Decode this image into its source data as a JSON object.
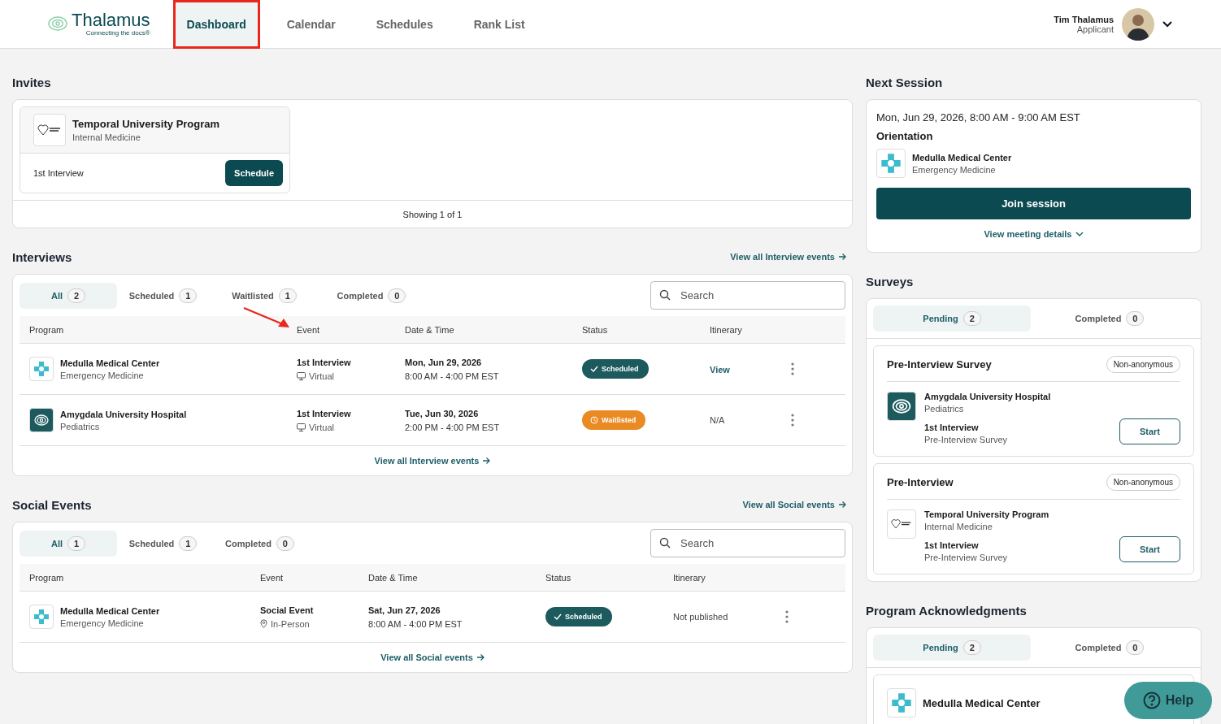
{
  "header": {
    "brand": "Thalamus",
    "tagline": "Connecting the docs®",
    "nav": [
      {
        "label": "Dashboard",
        "selected": true,
        "highlighted": true
      },
      {
        "label": "Calendar",
        "selected": false,
        "highlighted": false
      },
      {
        "label": "Schedules",
        "selected": false,
        "highlighted": false
      },
      {
        "label": "Rank List",
        "selected": false,
        "highlighted": false
      }
    ],
    "user": {
      "name": "Tim Thalamus",
      "role": "Applicant"
    }
  },
  "invites": {
    "title": "Invites",
    "cards": [
      {
        "program": "Temporal University Program",
        "specialty": "Internal Medicine",
        "logo": {
          "kind": "heart"
        },
        "event": "1st Interview",
        "button": "Schedule"
      }
    ],
    "footer": "Showing 1 of 1"
  },
  "sections": [
    {
      "title": "Interviews",
      "link": "View all Interview events",
      "search_placeholder": "Search",
      "tabs": [
        {
          "label": "All",
          "count": "2",
          "selected": true
        },
        {
          "label": "Scheduled",
          "count": "1",
          "selected": false
        },
        {
          "label": "Waitlisted",
          "count": "1",
          "selected": false
        },
        {
          "label": "Completed",
          "count": "0",
          "selected": false
        }
      ],
      "columns": [
        "Program",
        "Event",
        "Date & Time",
        "Status",
        "Itinerary"
      ],
      "rows": [
        {
          "program": "Medulla Medical Center",
          "specialty": "Emergency Medicine",
          "logo": {
            "kind": "cross"
          },
          "event": "1st Interview",
          "mode": {
            "kind": "virtual",
            "label": "Virtual"
          },
          "date": "Mon, Jun 29, 2026",
          "time": "8:00 AM - 4:00 PM EST",
          "status": {
            "kind": "scheduled",
            "label": "Scheduled"
          },
          "itinerary": {
            "kind": "link",
            "label": "View"
          }
        },
        {
          "program": "Amygdala University Hospital",
          "specialty": "Pediatrics",
          "logo": {
            "kind": "brain"
          },
          "event": "1st Interview",
          "mode": {
            "kind": "virtual",
            "label": "Virtual"
          },
          "date": "Tue, Jun 30, 2026",
          "time": "2:00 PM - 4:00 PM EST",
          "status": {
            "kind": "waitlisted",
            "label": "Waitlisted"
          },
          "itinerary": {
            "kind": "text",
            "label": "N/A"
          }
        }
      ],
      "footer_link": "View all Interview events",
      "annotation": {
        "kind": "arrow"
      }
    },
    {
      "title": "Social Events",
      "link": "View all Social events",
      "search_placeholder": "Search",
      "tabs": [
        {
          "label": "All",
          "count": "1",
          "selected": true
        },
        {
          "label": "Scheduled",
          "count": "1",
          "selected": false
        },
        {
          "label": "Completed",
          "count": "0",
          "selected": false
        }
      ],
      "columns": [
        "Program",
        "Event",
        "Date & Time",
        "Status",
        "Itinerary"
      ],
      "rows": [
        {
          "program": "Medulla Medical Center",
          "specialty": "Emergency Medicine",
          "logo": {
            "kind": "cross"
          },
          "event": "Social Event",
          "mode": {
            "kind": "in_person",
            "label": "In-Person"
          },
          "date": "Sat, Jun 27, 2026",
          "time": "8:00 AM - 4:00 PM EST",
          "status": {
            "kind": "scheduled",
            "label": "Scheduled"
          },
          "itinerary": {
            "kind": "text",
            "label": "Not published"
          }
        }
      ],
      "footer_link": "View all Social events"
    }
  ],
  "next_session": {
    "title": "Next Session",
    "datetime": "Mon, Jun 29, 2026, 8:00 AM - 9:00 AM EST",
    "name": "Orientation",
    "program": "Medulla Medical Center",
    "specialty": "Emergency Medicine",
    "logo": {
      "kind": "cross"
    },
    "join": "Join session",
    "details": "View meeting details"
  },
  "surveys": {
    "title": "Surveys",
    "tabs": [
      {
        "label": "Pending",
        "count": "2",
        "selected": true
      },
      {
        "label": "Completed",
        "count": "0",
        "selected": false
      }
    ],
    "items": [
      {
        "title": "Pre-Interview Survey",
        "badge": "Non-anonymous",
        "program": "Amygdala University Hospital",
        "specialty": "Pediatrics",
        "logo": {
          "kind": "brain"
        },
        "event": "1st Interview",
        "survey": "Pre-Interview Survey",
        "button": "Start"
      },
      {
        "title": "Pre-Interview",
        "badge": "Non-anonymous",
        "program": "Temporal University Program",
        "specialty": "Internal Medicine",
        "logo": {
          "kind": "heart"
        },
        "event": "1st Interview",
        "survey": "Pre-Interview Survey",
        "button": "Start"
      }
    ]
  },
  "acknowledgments": {
    "title": "Program Acknowledgments",
    "tabs": [
      {
        "label": "Pending",
        "count": "2",
        "selected": true
      },
      {
        "label": "Completed",
        "count": "0",
        "selected": false
      }
    ],
    "items": [
      {
        "program": "Medulla Medical Center",
        "logo": {
          "kind": "cross"
        }
      }
    ]
  },
  "help": {
    "label": "Help"
  }
}
